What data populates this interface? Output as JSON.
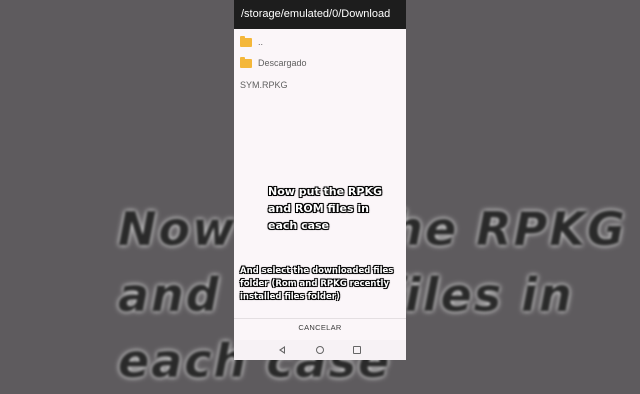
{
  "background_caption": {
    "line1": "Now put the RPKG",
    "line2": "and ROM files in",
    "line3": "each case"
  },
  "dialog": {
    "path": "/storage/emulated/0/Download",
    "entries": [
      {
        "name": "..",
        "type": "folder"
      },
      {
        "name": "Descargado",
        "type": "folder"
      },
      {
        "name": "SYM.RPKG",
        "type": "file"
      }
    ],
    "cancel_label": "CANCELAR"
  },
  "overlay": {
    "text1": "Now put the RPKG\nand ROM files in\neach case",
    "text2": "And select the downloaded files\nfolder (Rom and RPKG recently\ninstalled files folder)"
  },
  "colors": {
    "folder": "#f4b73a",
    "titlebar": "#1d1d1d",
    "panel": "#fbf6f9"
  },
  "icons": {
    "back": "back-triangle-icon",
    "home": "home-circle-icon",
    "recents": "recents-square-icon",
    "folder": "folder-icon"
  }
}
